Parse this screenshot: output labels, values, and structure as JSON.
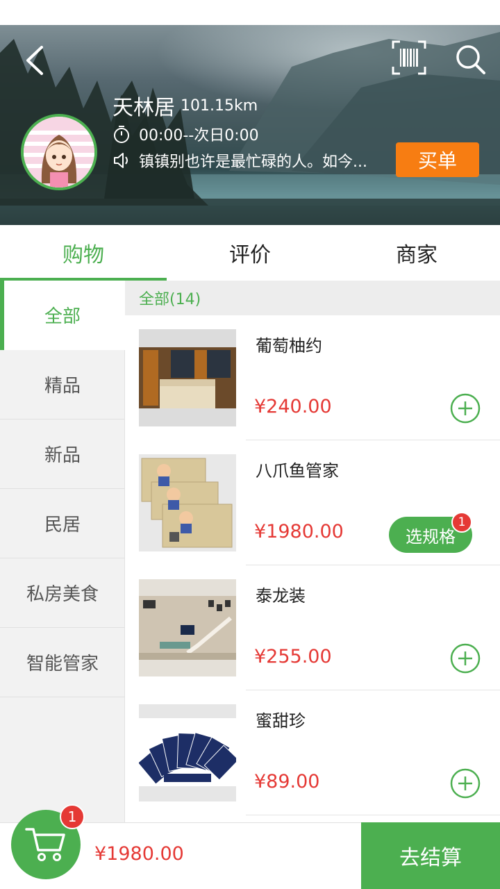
{
  "header": {
    "store_name": "天林居",
    "distance": "101.15km",
    "hours": "00:00--次日0:00",
    "notice": "镇镇别也许是最忙碌的人。如今...",
    "pay_button": "买单"
  },
  "tabs": [
    {
      "label": "购物",
      "active": true
    },
    {
      "label": "评价",
      "active": false
    },
    {
      "label": "商家",
      "active": false
    }
  ],
  "sidebar": {
    "items": [
      {
        "label": "全部",
        "active": true
      },
      {
        "label": "精品"
      },
      {
        "label": "新品"
      },
      {
        "label": "民居"
      },
      {
        "label": "私房美食"
      },
      {
        "label": "智能管家"
      }
    ]
  },
  "category_header": "全部(14)",
  "products": [
    {
      "name": "葡萄柚约",
      "price": "¥240.00"
    },
    {
      "name": "八爪鱼管家",
      "price": "¥1980.00",
      "spec_button": "选规格",
      "spec_count": "1"
    },
    {
      "name": "泰龙装",
      "price": "¥255.00"
    },
    {
      "name": "蜜甜珍",
      "price": "¥89.00"
    }
  ],
  "cart": {
    "badge": "1",
    "total": "¥1980.00",
    "checkout": "去结算"
  },
  "colors": {
    "accent": "#4caf50",
    "price": "#e53935",
    "pay": "#f77d12"
  }
}
